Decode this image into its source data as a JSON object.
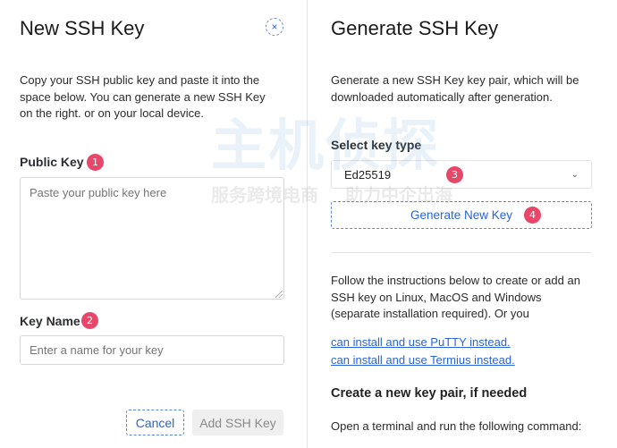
{
  "left_panel": {
    "title": "New SSH Key",
    "close_glyph": "×",
    "description": "Copy your SSH public key and paste it into the space below. You can generate a new SSH Key on the right. or on your local device.",
    "public_key": {
      "label": "Public Key",
      "badge": "1",
      "placeholder": "Paste your public key here",
      "value": ""
    },
    "key_name": {
      "label": "Key Name",
      "badge": "2",
      "placeholder": "Enter a name for your key",
      "value": ""
    },
    "cancel_label": "Cancel",
    "add_label": "Add SSH Key"
  },
  "right_panel": {
    "title": "Generate SSH Key",
    "description": "Generate a new SSH Key key pair, which will be downloaded automatically after generation.",
    "key_type": {
      "label": "Select key type",
      "selected": "Ed25519",
      "badge": "3",
      "chevron_icon": "chevron-down-icon"
    },
    "generate_label": "Generate New Key",
    "generate_badge": "4",
    "instructions": "Follow the instructions below to create or add an SSH key on Linux, MacOS and Windows (separate installation required). Or you",
    "link_putty": "can install and use PuTTY instead.",
    "link_termius": "can install and use Termius instead.",
    "create_heading": "Create a new key pair, if needed",
    "terminal_text": "Open a terminal and run the following command:"
  },
  "watermark": {
    "brand": "主机侦探",
    "tagline_1": "服务跨境电商",
    "tagline_2": "助力中企出海"
  },
  "colors": {
    "accent": "#2a64d6",
    "badge": "#e8476a",
    "border": "#d6d6d6"
  }
}
